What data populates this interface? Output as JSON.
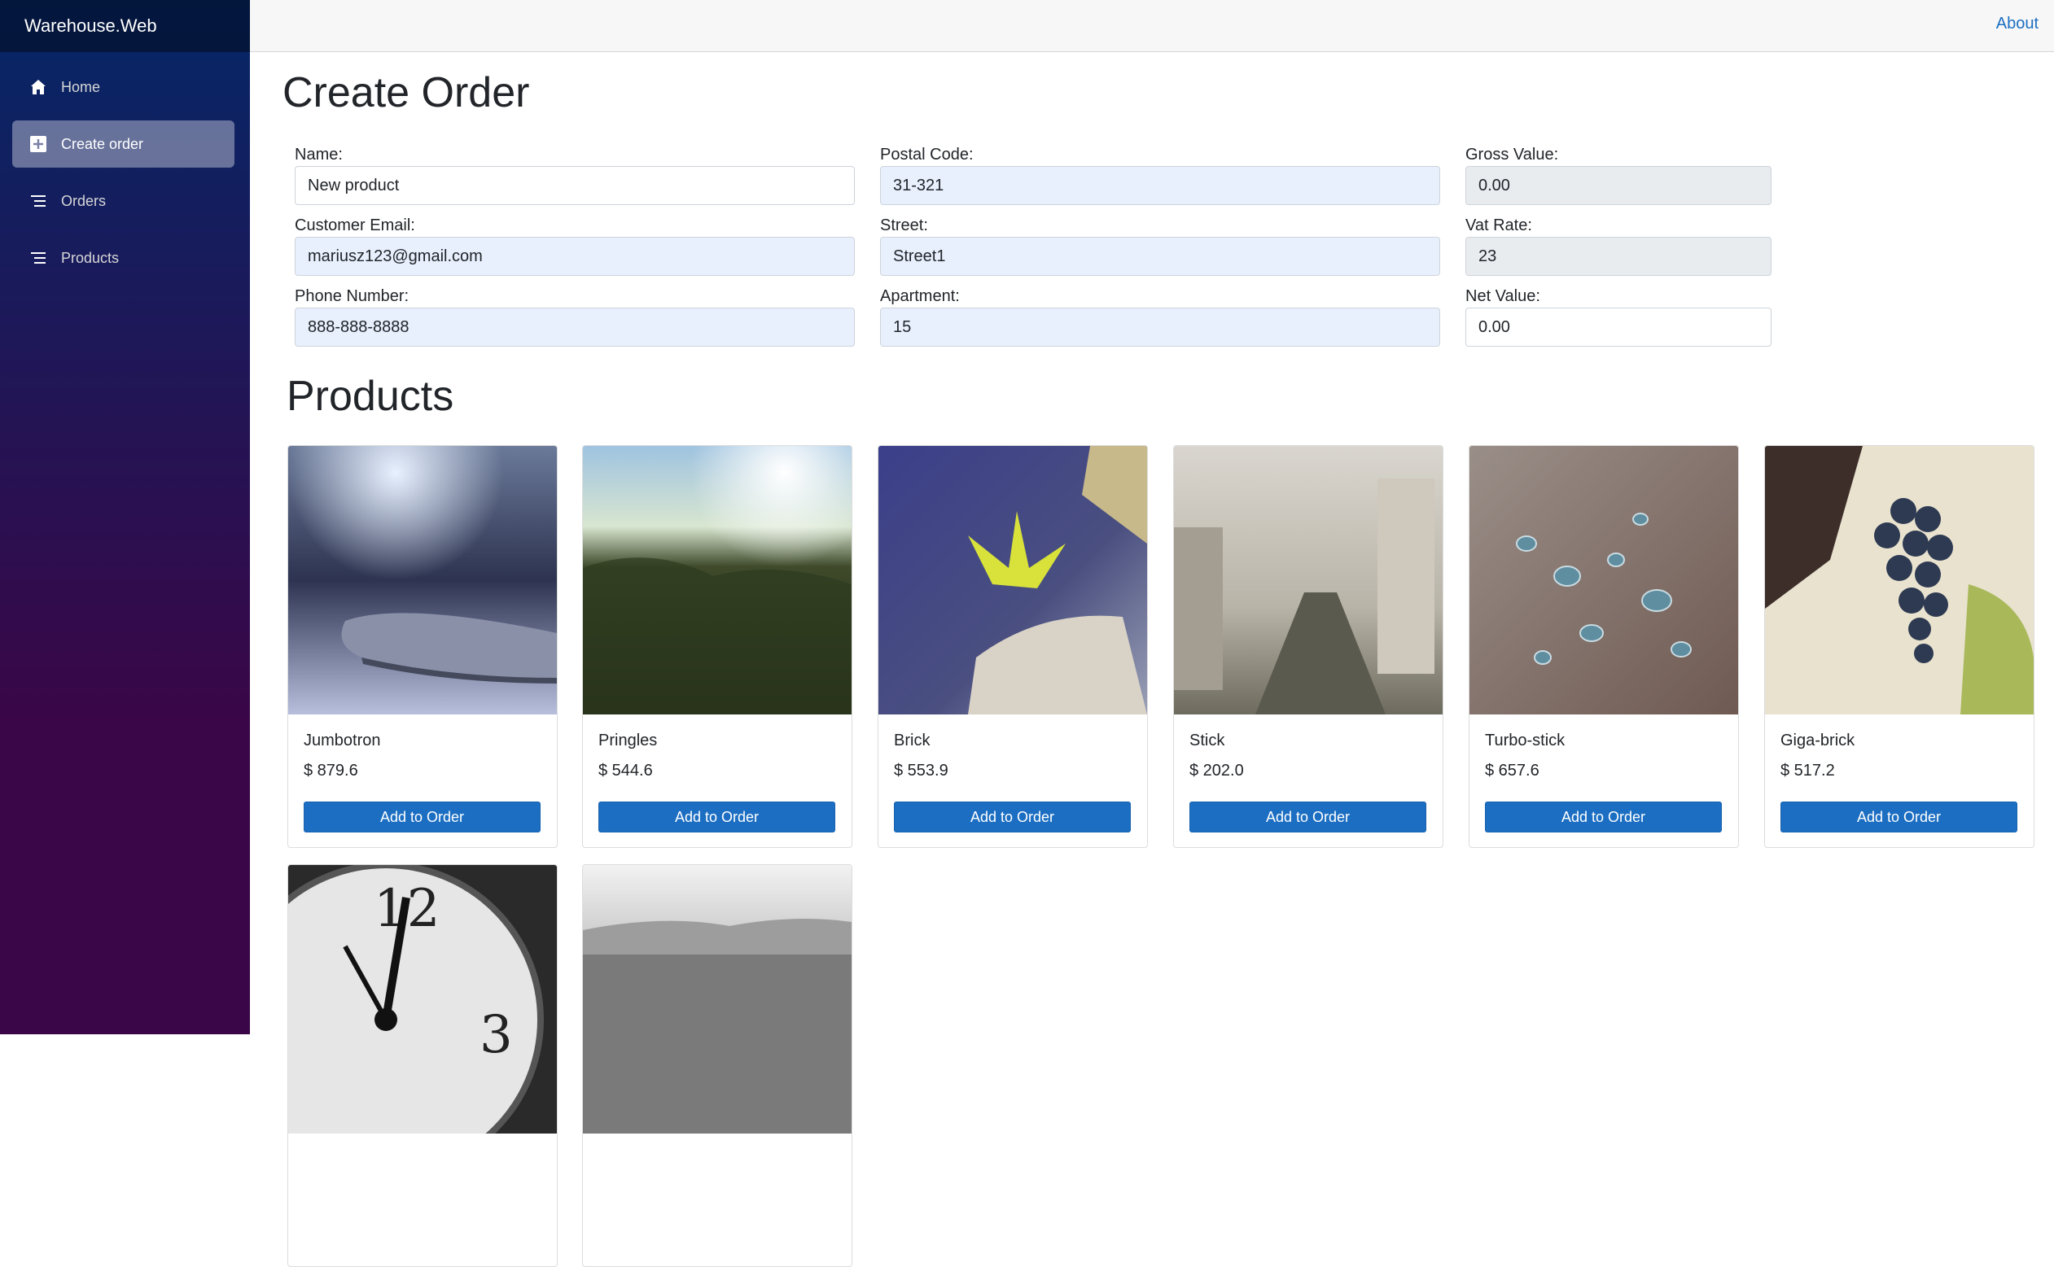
{
  "app": {
    "brand": "Warehouse.Web"
  },
  "nav": {
    "items": [
      {
        "label": "Home",
        "icon": "home-icon"
      },
      {
        "label": "Create order",
        "icon": "plus-square-icon",
        "active": true
      },
      {
        "label": "Orders",
        "icon": "list-icon"
      },
      {
        "label": "Products",
        "icon": "list-icon"
      }
    ]
  },
  "top": {
    "about": "About"
  },
  "page": {
    "title": "Create Order"
  },
  "form": {
    "name": {
      "label": "Name:",
      "value": "New product"
    },
    "email": {
      "label": "Customer Email:",
      "value": "mariusz123@gmail.com"
    },
    "phone": {
      "label": "Phone Number:",
      "value": "888-888-8888"
    },
    "postal": {
      "label": "Postal Code:",
      "value": "31-321"
    },
    "street": {
      "label": "Street:",
      "value": "Street1"
    },
    "apartment": {
      "label": "Apartment:",
      "value": "15"
    },
    "gross": {
      "label": "Gross Value:",
      "value": "0.00"
    },
    "vat": {
      "label": "Vat Rate:",
      "value": "23"
    },
    "net": {
      "label": "Net Value:",
      "value": "0.00"
    }
  },
  "products": {
    "title": "Products",
    "add_label": "Add to Order",
    "items": [
      {
        "name": "Jumbotron",
        "price": "$ 879.6",
        "image": "phone-photo"
      },
      {
        "name": "Pringles",
        "price": "$ 544.6",
        "image": "grass-photo"
      },
      {
        "name": "Brick",
        "price": "$ 553.9",
        "image": "flower-photo"
      },
      {
        "name": "Stick",
        "price": "$ 202.0",
        "image": "rainy-city-photo"
      },
      {
        "name": "Turbo-stick",
        "price": "$ 657.6",
        "image": "water-drops-photo"
      },
      {
        "name": "Giga-brick",
        "price": "$ 517.2",
        "image": "grapes-photo"
      },
      {
        "name": "",
        "price": "",
        "image": "clock-photo"
      },
      {
        "name": "",
        "price": "",
        "image": "city-landscape-photo"
      }
    ]
  },
  "colors": {
    "accent": "#1b6ec2",
    "sidebar_top": "#052767",
    "sidebar_bottom": "#3a0647",
    "autofill": "#e8f0fe",
    "readonly": "#e9ecef"
  }
}
